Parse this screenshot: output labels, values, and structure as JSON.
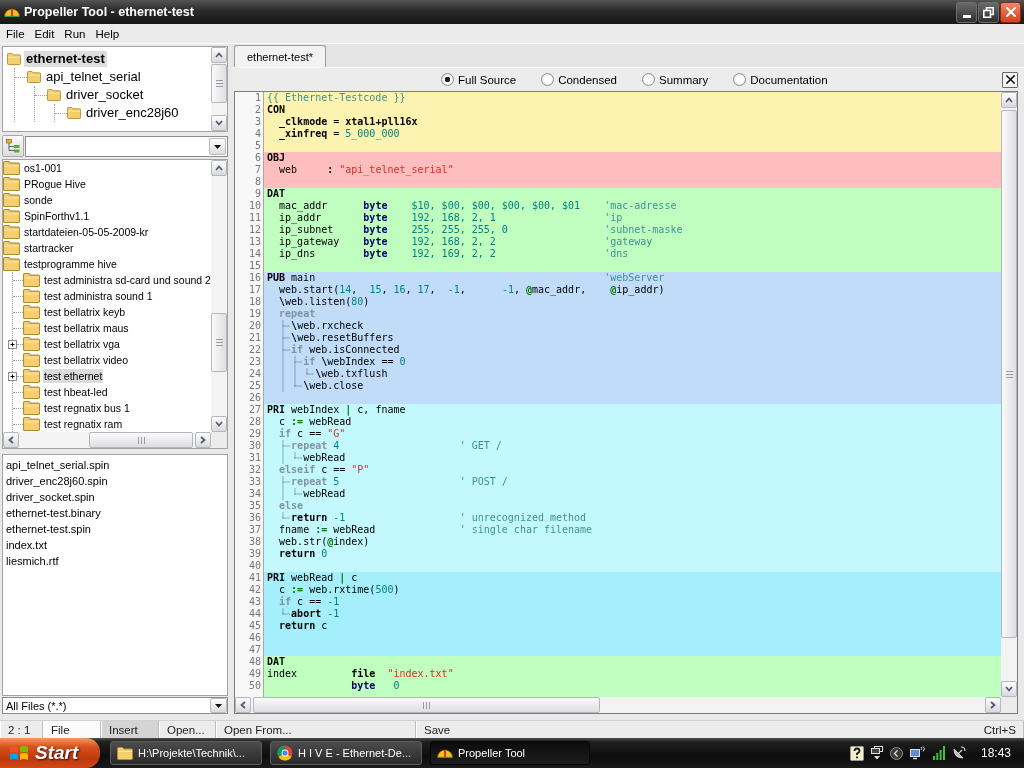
{
  "window": {
    "title": "Propeller Tool - ethernet-test"
  },
  "menu": [
    "File",
    "Edit",
    "Run",
    "Help"
  ],
  "object_tree": {
    "items": [
      {
        "label": "ethernet-test",
        "selected": true,
        "children": [
          {
            "label": "api_telnet_serial",
            "selected": false,
            "children": [
              {
                "label": "driver_socket",
                "selected": false,
                "children": [
                  {
                    "label": "driver_enc28j60",
                    "selected": false
                  }
                ]
              }
            ]
          }
        ]
      }
    ]
  },
  "folder_tree": {
    "items": [
      {
        "label": "os1-001",
        "selected": false,
        "collapsed": false
      },
      {
        "label": "PRogue Hive",
        "selected": false,
        "collapsed": false
      },
      {
        "label": "sonde",
        "selected": false,
        "collapsed": false
      },
      {
        "label": "SpinForthv1.1",
        "selected": false,
        "collapsed": false
      },
      {
        "label": "startdateien-05-05-2009-kr",
        "selected": false,
        "collapsed": false
      },
      {
        "label": "startracker",
        "selected": false,
        "collapsed": false
      },
      {
        "label": "testprogramme hive",
        "selected": false,
        "collapsed": false,
        "children": [
          {
            "label": "test administra sd-card und sound 2",
            "selected": false,
            "collapsed": false
          },
          {
            "label": "test administra sound 1",
            "selected": false,
            "collapsed": false
          },
          {
            "label": "test bellatrix keyb",
            "selected": false,
            "collapsed": false
          },
          {
            "label": "test bellatrix maus",
            "selected": false,
            "collapsed": false
          },
          {
            "label": "test bellatrix vga",
            "selected": false,
            "collapsed": true
          },
          {
            "label": "test bellatrix video",
            "selected": false,
            "collapsed": false
          },
          {
            "label": "test ethernet",
            "selected": true,
            "collapsed": true
          },
          {
            "label": "test hbeat-led",
            "selected": false,
            "collapsed": false
          },
          {
            "label": "test regnatix bus 1",
            "selected": false,
            "collapsed": false
          },
          {
            "label": "test regnatix ram",
            "selected": false,
            "collapsed": false
          }
        ]
      }
    ]
  },
  "files": [
    "api_telnet_serial.spin",
    "driver_enc28j60.spin",
    "driver_socket.spin",
    "ethernet-test.binary",
    "ethernet-test.spin",
    "index.txt",
    "liesmich.rtf"
  ],
  "file_filter": {
    "value": "All Files (*.*)"
  },
  "tabs": [
    {
      "label": "ethernet-test*",
      "selected": true
    }
  ],
  "view_options": [
    {
      "label": "Full Source",
      "selected": true
    },
    {
      "label": "Condensed",
      "selected": false
    },
    {
      "label": "Summary",
      "selected": false
    },
    {
      "label": "Documentation",
      "selected": false
    }
  ],
  "editor": {
    "blocks": [
      {
        "kind": "con",
        "alternate": false,
        "lines": [
          {
            "number": "1",
            "tokens": [
              {
                "kind": "comment",
                "text": "{{ Ethernet-Testcode }}"
              }
            ]
          },
          {
            "number": "2",
            "tokens": [
              {
                "kind": "keyword",
                "text": "CON"
              }
            ]
          },
          {
            "number": "3",
            "tokens": [
              {
                "kind": "keyword",
                "text": "  _clkmode"
              },
              {
                "kind": "plain",
                "text": " = "
              },
              {
                "kind": "keyword",
                "text": "xtal1+pll16x"
              }
            ]
          },
          {
            "number": "4",
            "tokens": [
              {
                "kind": "keyword",
                "text": "  _xinfreq"
              },
              {
                "kind": "plain",
                "text": " = "
              },
              {
                "kind": "number",
                "text": "5_000_000"
              }
            ]
          },
          {
            "number": "5"
          }
        ]
      },
      {
        "kind": "obj",
        "alternate": false,
        "lines": [
          {
            "number": "6",
            "tokens": [
              {
                "kind": "keyword",
                "text": "OBJ"
              }
            ]
          },
          {
            "number": "7",
            "tokens": [
              {
                "kind": "plain",
                "text": "  web     "
              },
              {
                "kind": "keyword",
                "text": ":"
              },
              {
                "kind": "string",
                "text": " \"api_telnet_serial\""
              }
            ]
          },
          {
            "number": "8"
          }
        ]
      },
      {
        "kind": "dat",
        "alternate": false,
        "lines": [
          {
            "number": "9",
            "tokens": [
              {
                "kind": "keyword",
                "text": "DAT"
              }
            ]
          },
          {
            "number": "10",
            "tokens": [
              {
                "kind": "plain",
                "text": "  mac_addr      "
              },
              {
                "kind": "type",
                "text": "byte"
              },
              {
                "kind": "number",
                "text": "    $10, $00, $00, $00, $00, $01"
              },
              {
                "kind": "comment",
                "text": "    'mac-adresse"
              }
            ]
          },
          {
            "number": "11",
            "tokens": [
              {
                "kind": "plain",
                "text": "  ip_addr       "
              },
              {
                "kind": "type",
                "text": "byte"
              },
              {
                "kind": "number",
                "text": "    192, 168, 2, 1"
              },
              {
                "kind": "comment",
                "text": "                  'ip"
              }
            ]
          },
          {
            "number": "12",
            "tokens": [
              {
                "kind": "plain",
                "text": "  ip_subnet     "
              },
              {
                "kind": "type",
                "text": "byte"
              },
              {
                "kind": "number",
                "text": "    255, 255, 255, 0"
              },
              {
                "kind": "comment",
                "text": "                'subnet-maske"
              }
            ]
          },
          {
            "number": "13",
            "tokens": [
              {
                "kind": "plain",
                "text": "  ip_gateway    "
              },
              {
                "kind": "type",
                "text": "byte"
              },
              {
                "kind": "number",
                "text": "    192, 168, 2, 2"
              },
              {
                "kind": "comment",
                "text": "                  'gateway"
              }
            ]
          },
          {
            "number": "14",
            "tokens": [
              {
                "kind": "plain",
                "text": "  ip_dns        "
              },
              {
                "kind": "type",
                "text": "byte"
              },
              {
                "kind": "number",
                "text": "    192, 169, 2, 2"
              },
              {
                "kind": "comment",
                "text": "                  'dns"
              }
            ]
          },
          {
            "number": "15"
          }
        ]
      },
      {
        "kind": "pub",
        "alternate": false,
        "lines": [
          {
            "number": "16",
            "tokens": [
              {
                "kind": "keyword",
                "text": "PUB"
              },
              {
                "kind": "plain",
                "text": " main"
              },
              {
                "kind": "comment",
                "text": "                                                'webServer"
              }
            ]
          },
          {
            "number": "17",
            "tokens": [
              {
                "kind": "plain",
                "text": "  web.start("
              },
              {
                "kind": "number",
                "text": "14"
              },
              {
                "kind": "plain",
                "text": ",  "
              },
              {
                "kind": "number",
                "text": "15"
              },
              {
                "kind": "plain",
                "text": ", "
              },
              {
                "kind": "number",
                "text": "16"
              },
              {
                "kind": "plain",
                "text": ", "
              },
              {
                "kind": "number",
                "text": "17"
              },
              {
                "kind": "plain",
                "text": ",  "
              },
              {
                "kind": "number",
                "text": "-1"
              },
              {
                "kind": "plain",
                "text": ",      "
              },
              {
                "kind": "number",
                "text": "-1"
              },
              {
                "kind": "plain",
                "text": ", "
              },
              {
                "kind": "symbol",
                "text": "@"
              },
              {
                "kind": "plain",
                "text": "mac_addr,    "
              },
              {
                "kind": "symbol",
                "text": "@"
              },
              {
                "kind": "plain",
                "text": "ip_addr)"
              }
            ]
          },
          {
            "number": "18",
            "tokens": [
              {
                "kind": "keyword",
                "text": "  \\"
              },
              {
                "kind": "plain",
                "text": "web.listen("
              },
              {
                "kind": "number",
                "text": "80"
              },
              {
                "kind": "plain",
                "text": ")"
              }
            ]
          },
          {
            "number": "19",
            "tokens": [
              {
                "kind": "flow",
                "text": "  repeat"
              }
            ]
          },
          {
            "number": "20",
            "tokens": [
              {
                "kind": "keyword",
                "text": "    \\"
              },
              {
                "kind": "plain",
                "text": "web.rxcheck"
              }
            ]
          },
          {
            "number": "21",
            "tokens": [
              {
                "kind": "keyword",
                "text": "    \\"
              },
              {
                "kind": "plain",
                "text": "web.resetBuffers"
              }
            ]
          },
          {
            "number": "22",
            "tokens": [
              {
                "kind": "flow",
                "text": "    if"
              },
              {
                "kind": "plain",
                "text": " web.isConnected"
              }
            ]
          },
          {
            "number": "23",
            "tokens": [
              {
                "kind": "flow",
                "text": "      if"
              },
              {
                "kind": "keyword",
                "text": " \\"
              },
              {
                "kind": "plain",
                "text": "webIndex == "
              },
              {
                "kind": "number",
                "text": "0"
              }
            ]
          },
          {
            "number": "24",
            "tokens": [
              {
                "kind": "keyword",
                "text": "        \\"
              },
              {
                "kind": "plain",
                "text": "web.txflush"
              }
            ]
          },
          {
            "number": "25",
            "tokens": [
              {
                "kind": "keyword",
                "text": "      \\"
              },
              {
                "kind": "plain",
                "text": "web.close"
              }
            ]
          },
          {
            "number": "26"
          }
        ]
      },
      {
        "kind": "pri",
        "alternate": false,
        "lines": [
          {
            "number": "27",
            "tokens": [
              {
                "kind": "keyword",
                "text": "PRI"
              },
              {
                "kind": "plain",
                "text": " webIndex "
              },
              {
                "kind": "symbol",
                "text": "|"
              },
              {
                "kind": "plain",
                "text": " c, fname"
              }
            ]
          },
          {
            "number": "28",
            "tokens": [
              {
                "kind": "plain",
                "text": "  c "
              },
              {
                "kind": "symbol",
                "text": ":="
              },
              {
                "kind": "plain",
                "text": " webRead"
              }
            ]
          },
          {
            "number": "29",
            "tokens": [
              {
                "kind": "flow",
                "text": "  if"
              },
              {
                "kind": "plain",
                "text": " c == "
              },
              {
                "kind": "string",
                "text": "\"G\""
              }
            ]
          },
          {
            "number": "30",
            "tokens": [
              {
                "kind": "flow",
                "text": "    repeat"
              },
              {
                "kind": "number",
                "text": " 4"
              },
              {
                "kind": "comment",
                "text": "                    ' GET /"
              }
            ]
          },
          {
            "number": "31",
            "tokens": [
              {
                "kind": "plain",
                "text": "      webRead"
              }
            ]
          },
          {
            "number": "32",
            "tokens": [
              {
                "kind": "flow",
                "text": "  elseif"
              },
              {
                "kind": "plain",
                "text": " c == "
              },
              {
                "kind": "string",
                "text": "\"P\""
              }
            ]
          },
          {
            "number": "33",
            "tokens": [
              {
                "kind": "flow",
                "text": "    repeat"
              },
              {
                "kind": "number",
                "text": " 5"
              },
              {
                "kind": "comment",
                "text": "                    ' POST /"
              }
            ]
          },
          {
            "number": "34",
            "tokens": [
              {
                "kind": "plain",
                "text": "      webRead"
              }
            ]
          },
          {
            "number": "35",
            "tokens": [
              {
                "kind": "flow",
                "text": "  else"
              }
            ]
          },
          {
            "number": "36",
            "tokens": [
              {
                "kind": "keyword",
                "text": "    return"
              },
              {
                "kind": "number",
                "text": " -1"
              },
              {
                "kind": "comment",
                "text": "                   ' unrecognized method"
              }
            ]
          },
          {
            "number": "37",
            "tokens": [
              {
                "kind": "plain",
                "text": "  fname "
              },
              {
                "kind": "symbol",
                "text": ":="
              },
              {
                "kind": "plain",
                "text": " webRead"
              },
              {
                "kind": "comment",
                "text": "              ' single char filename"
              }
            ]
          },
          {
            "number": "38",
            "tokens": [
              {
                "kind": "plain",
                "text": "  web.str("
              },
              {
                "kind": "symbol",
                "text": "@"
              },
              {
                "kind": "plain",
                "text": "index)"
              }
            ]
          },
          {
            "number": "39",
            "tokens": [
              {
                "kind": "keyword",
                "text": "  return"
              },
              {
                "kind": "number",
                "text": " 0"
              }
            ]
          },
          {
            "number": "40"
          }
        ]
      },
      {
        "kind": "pri",
        "alternate": true,
        "lines": [
          {
            "number": "41",
            "tokens": [
              {
                "kind": "keyword",
                "text": "PRI"
              },
              {
                "kind": "plain",
                "text": " webRead "
              },
              {
                "kind": "symbol",
                "text": "|"
              },
              {
                "kind": "plain",
                "text": " c"
              }
            ]
          },
          {
            "number": "42",
            "tokens": [
              {
                "kind": "plain",
                "text": "  c "
              },
              {
                "kind": "symbol",
                "text": ":="
              },
              {
                "kind": "plain",
                "text": " web.rxtime("
              },
              {
                "kind": "number",
                "text": "500"
              },
              {
                "kind": "plain",
                "text": ")"
              }
            ]
          },
          {
            "number": "43",
            "tokens": [
              {
                "kind": "flow",
                "text": "  if"
              },
              {
                "kind": "plain",
                "text": " c == "
              },
              {
                "kind": "number",
                "text": "-1"
              }
            ]
          },
          {
            "number": "44",
            "tokens": [
              {
                "kind": "keyword",
                "text": "    abort"
              },
              {
                "kind": "number",
                "text": " -1"
              }
            ]
          },
          {
            "number": "45",
            "tokens": [
              {
                "kind": "keyword",
                "text": "  return"
              },
              {
                "kind": "plain",
                "text": " c"
              }
            ]
          },
          {
            "number": "46"
          },
          {
            "number": "47"
          }
        ]
      },
      {
        "kind": "dat",
        "alternate": false,
        "lines": [
          {
            "number": "48",
            "tokens": [
              {
                "kind": "keyword",
                "text": "DAT"
              }
            ]
          },
          {
            "number": "49",
            "tokens": [
              {
                "kind": "plain",
                "text": "index         "
              },
              {
                "kind": "keyword",
                "text": "file"
              },
              {
                "kind": "string",
                "text": "  \"index.txt\""
              }
            ]
          },
          {
            "number": "50",
            "tokens": [
              {
                "kind": "type",
                "text": "              byte"
              },
              {
                "kind": "number",
                "text": "   0"
              }
            ]
          }
        ]
      }
    ]
  },
  "status_bar": [
    {
      "kind": "position",
      "text": "2 : 1"
    },
    {
      "kind": "field",
      "text": "File"
    },
    {
      "kind": "mode",
      "text": "Insert"
    },
    {
      "kind": "hint",
      "text": "Open..."
    },
    {
      "kind": "hint",
      "text": "Open From..."
    },
    {
      "kind": "shortcut",
      "text": "Save",
      "shortcut": "Ctrl+S"
    }
  ],
  "taskbar": {
    "start": "Start",
    "tasks": [
      {
        "kind": "folder",
        "label": "H:\\Projekte\\Technik\\...",
        "selected": false
      },
      {
        "kind": "browser",
        "label": "H I V E - Ethernet-De...",
        "selected": false
      },
      {
        "kind": "app",
        "label": "Propeller Tool",
        "selected": true
      }
    ],
    "clock": "18:43"
  }
}
